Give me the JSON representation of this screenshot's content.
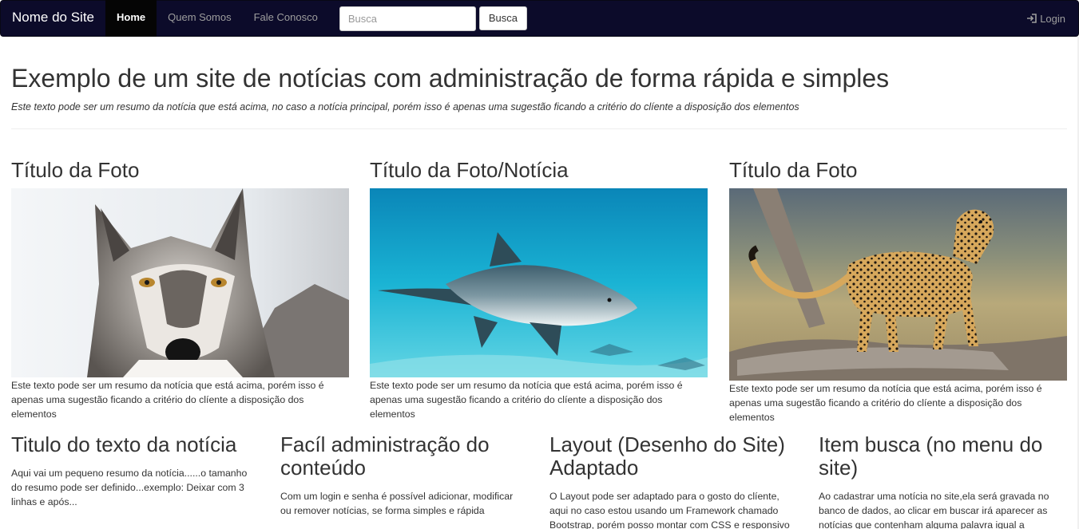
{
  "navbar": {
    "brand": "Nome do Site",
    "items": [
      {
        "label": "Home",
        "active": true
      },
      {
        "label": "Quem Somos",
        "active": false
      },
      {
        "label": "Fale Conosco",
        "active": false
      }
    ],
    "search_placeholder": "Busca",
    "search_button": "Busca",
    "login_label": "Login",
    "login_icon": "login-icon"
  },
  "header": {
    "title": "Exemplo de um site de notícias com administração de forma rápida e simples",
    "lead": "Este texto pode ser um resumo da notícia que está acima, no caso a notícia principal, porém isso é apenas uma sugestão ficando a critério do clíente a disposição dos elementos"
  },
  "cards": [
    {
      "title": "Título da Foto",
      "image": "wolf-photo",
      "text": "Este texto pode ser um resumo da notícia que está acima, porém isso é apenas uma sugestão ficando a critério do clíente a disposição dos elementos"
    },
    {
      "title": "Título da Foto/Notícia",
      "image": "shark-photo",
      "text": "Este texto pode ser um resumo da notícia que está acima, porém isso é apenas uma sugestão ficando a critério do clíente a disposição dos elementos"
    },
    {
      "title": "Título da Foto",
      "image": "cheetah-photo",
      "text": "Este texto pode ser um resumo da notícia que está acima, porém isso é apenas uma sugestão ficando a critério do clíente a disposição dos elementos"
    }
  ],
  "columns": [
    {
      "title": "Titulo do texto da notícia",
      "text": "Aqui vai um pequeno resumo da notícia......o tamanho do resumo pode ser definido...exemplo: Deixar com 3 linhas e após..."
    },
    {
      "title": "Facíl administração do conteúdo",
      "text": "Com um login e senha é possível adicionar, modificar ou remover notícias, se forma simples e rápida"
    },
    {
      "title": "Layout (Desenho do Site) Adaptado",
      "text": "O Layout pode ser adaptado para o gosto do clíente, aqui no caso estou usando um Framework chamado Bootstrap, porém posso montar com CSS e responsivo"
    },
    {
      "title": "Item busca (no menu do site)",
      "text": "Ao cadastrar uma notícia no site,ela será gravada no banco de dados, ao clicar em buscar irá aparecer as notícias que contenham alguma palavra igual a"
    }
  ],
  "colors": {
    "navbar_bg": "#0c0b2a",
    "nav_active_bg": "#050505",
    "nav_text": "#9d9d9d",
    "body_text": "#333333"
  }
}
